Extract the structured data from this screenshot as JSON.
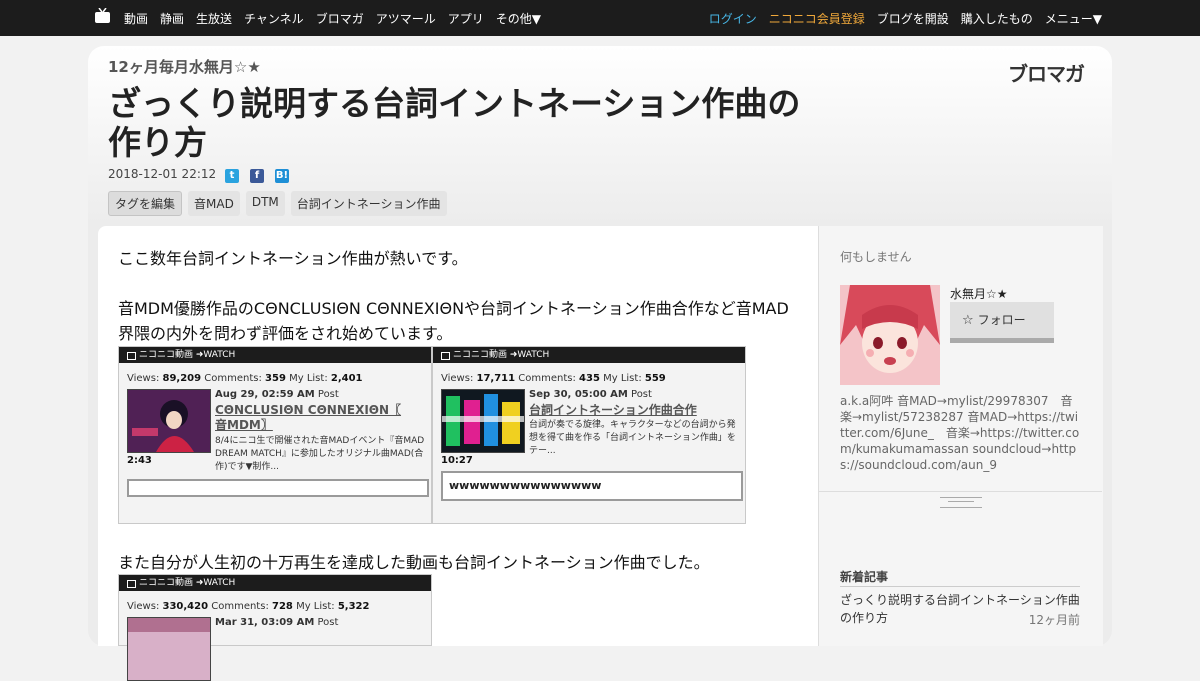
{
  "nav": {
    "left": [
      "動画",
      "静画",
      "生放送",
      "チャンネル",
      "ブロマガ",
      "アツマール",
      "アプリ",
      "その他▼"
    ],
    "login": "ログイン",
    "register": "ニコニコ会員登録",
    "blog": "ブログを開設",
    "purchased": "購入したもの",
    "menu": "メニュー▼"
  },
  "header": {
    "series": "12ヶ月毎月水無月☆★",
    "brand": "ブロマガ",
    "title": "ざっくり説明する台詞イントネーション作曲の作り方",
    "date": "2018-12-01 22:12",
    "share": [
      "t",
      "f",
      "B!"
    ],
    "tag_edit": "タグを編集",
    "tags": [
      "音MAD",
      "DTM",
      "台詞イントネーション作曲"
    ]
  },
  "article": {
    "p1": "ここ数年台詞イントネーション作曲が熱いです。",
    "p2": "音MDM優勝作品のCΘNCⅬUSIΘN CΘNNEXIΘNや台詞イントネーション作曲合作など音MAD界隈の内外を問わず評価をされ始めています。",
    "p3": "また自分が人生初の十万再生を達成した動画も台詞イントネーション作曲でした。",
    "embeds": [
      {
        "header": "ニコニコ動画 ➜WATCH",
        "views_label": "Views:",
        "views": "89,209",
        "comments_label": "Comments:",
        "comments": "359",
        "mylist_label": "My List:",
        "mylist": "2,401",
        "date": "Aug 29, 02:59 AM",
        "post": "Post",
        "title": "CΘNCⅬUSIΘN CΘNNEXIΘN〖 音MDM〗",
        "desc": "8/4にニコ生で開催された音MADイベント『音MAD DREAM MATCH』に参加したオリジナル曲MAD(合作)です▼制作...",
        "duration": "2:43",
        "comment": ""
      },
      {
        "header": "ニコニコ動画 ➜WATCH",
        "views_label": "Views:",
        "views": "17,711",
        "comments_label": "Comments:",
        "comments": "435",
        "mylist_label": "My List:",
        "mylist": "559",
        "date": "Sep 30, 05:00 AM",
        "post": "Post",
        "title": "台詞イントネーション作曲合作",
        "desc": "台詞が奏でる旋律。キャラクターなどの台詞から発想を得て曲を作る「台詞イントネーション作曲」をテー...",
        "duration": "10:27",
        "comment": "wwwwwwwwwwwwwww"
      },
      {
        "header": "ニコニコ動画 ➜WATCH",
        "views_label": "Views:",
        "views": "330,420",
        "comments_label": "Comments:",
        "comments": "728",
        "mylist_label": "My List:",
        "mylist": "5,322",
        "date": "Mar 31, 03:09 AM",
        "post": "Post"
      }
    ]
  },
  "sidebar": {
    "status": "何もしません",
    "username": "水無月☆★",
    "follow": "フォロー",
    "bio": "a.k.a阿吽 音MAD→mylist/29978307　音楽→mylist/57238287 音MAD→https://twitter.com/6June_　音楽→https://twitter.com/kumakumamassan soundcloud→https://soundcloud.com/aun_9",
    "news_heading": "新着記事",
    "news_title": "ざっくり説明する台詞イントネーション作曲の作り方",
    "news_ago": "12ヶ月前"
  },
  "colors": {
    "nav_bg": "#1c1c1c",
    "login": "#47b6e6",
    "register": "#f0a83a",
    "twitter": "#2aa3df",
    "facebook": "#3b5998",
    "hatena": "#1e8fd6"
  }
}
